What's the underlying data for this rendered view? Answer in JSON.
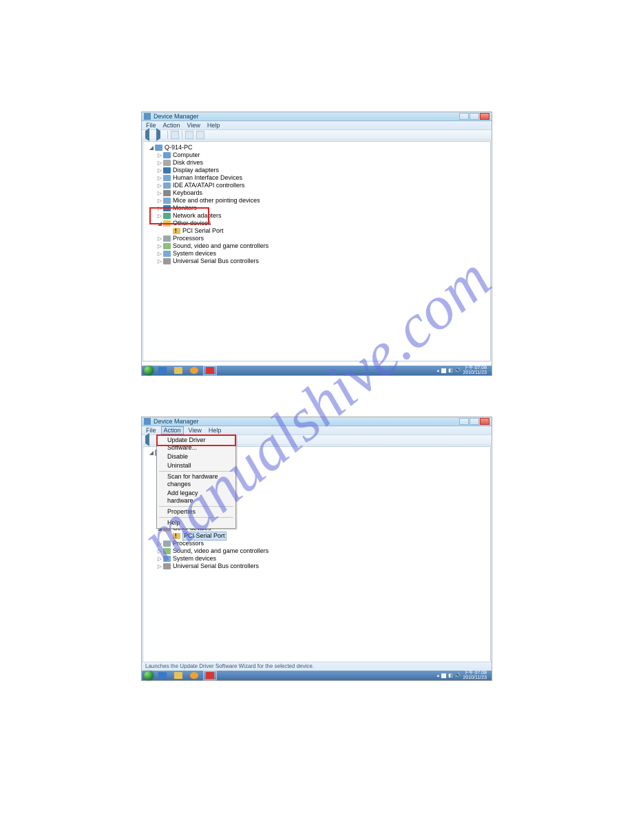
{
  "watermark": "manualshive.com",
  "window_title": "Device Manager",
  "menus": {
    "file": "File",
    "action": "Action",
    "view": "View",
    "help": "Help"
  },
  "root_node": "Q-914-PC",
  "tree_items": {
    "computer": "Computer",
    "disk": "Disk drives",
    "display": "Display adapters",
    "hid": "Human Interface Devices",
    "ide": "IDE ATA/ATAPI controllers",
    "keyboards": "Keyboards",
    "mice": "Mice and other pointing devices",
    "monitors": "Monitors",
    "network": "Network adapters",
    "other": "Other devices",
    "pci_serial": "PCI Serial Port",
    "processors": "Processors",
    "sound": "Sound, video and game controllers",
    "system": "System devices",
    "usb": "Universal Serial Bus controllers"
  },
  "action_menu": {
    "update": "Update Driver Software...",
    "disable": "Disable",
    "uninstall": "Uninstall",
    "scan": "Scan for hardware changes",
    "addlegacy": "Add legacy hardware",
    "properties": "Properties",
    "help": "Help"
  },
  "statusbar_text": "Launches the Update Driver Software Wizard for the selected device.",
  "clock": {
    "time": "下午 07:08",
    "date": "2010/11/23"
  }
}
